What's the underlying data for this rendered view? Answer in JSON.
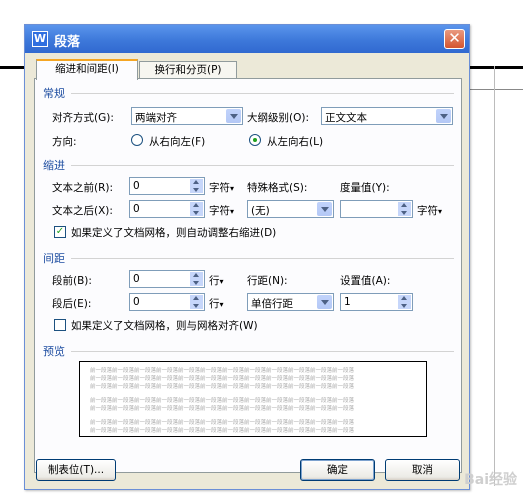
{
  "window": {
    "title": "段落",
    "app_icon": "W",
    "close_glyph": "✕"
  },
  "tabs": [
    {
      "label": "缩进和间距(I)"
    },
    {
      "label": "换行和分页(P)"
    }
  ],
  "general": {
    "heading": "常规",
    "alignment_label": "对齐方式(G):",
    "alignment_value": "两端对齐",
    "outline_label": "大纲级别(O):",
    "outline_value": "正文文本",
    "direction_label": "方向:",
    "rtl_label": "从右向左(F)",
    "ltr_label": "从左向右(L)",
    "selected_direction": "ltr"
  },
  "indent": {
    "heading": "缩进",
    "before_label": "文本之前(R):",
    "before_value": "0",
    "before_unit": "字符",
    "after_label": "文本之后(X):",
    "after_value": "0",
    "after_unit": "字符",
    "special_label": "特殊格式(S):",
    "special_value": "(无)",
    "measure_label": "度量值(Y):",
    "measure_value": "",
    "measure_unit": "字符",
    "grid_checkbox_label": "如果定义了文档网格，则自动调整右缩进(D)",
    "grid_checked": true
  },
  "spacing": {
    "heading": "间距",
    "before_label": "段前(B):",
    "before_value": "0",
    "before_unit": "行",
    "after_label": "段后(E):",
    "after_value": "0",
    "after_unit": "行",
    "line_label": "行距(N):",
    "line_value": "单倍行距",
    "setting_label": "设置值(A):",
    "setting_value": "1",
    "snap_checkbox_label": "如果定义了文档网格，则与网格对齐(W)",
    "snap_checked": false
  },
  "preview": {
    "heading": "预览",
    "line_text": "前一段落前一段落前一段落前一段落前一段落前一段落前一段落前一段落前一段落前一段落前一段落前一段落"
  },
  "footer": {
    "tabs_button": "制表位(T)...",
    "ok_button": "确定",
    "cancel_button": "取消"
  },
  "watermark": "Bai经验"
}
